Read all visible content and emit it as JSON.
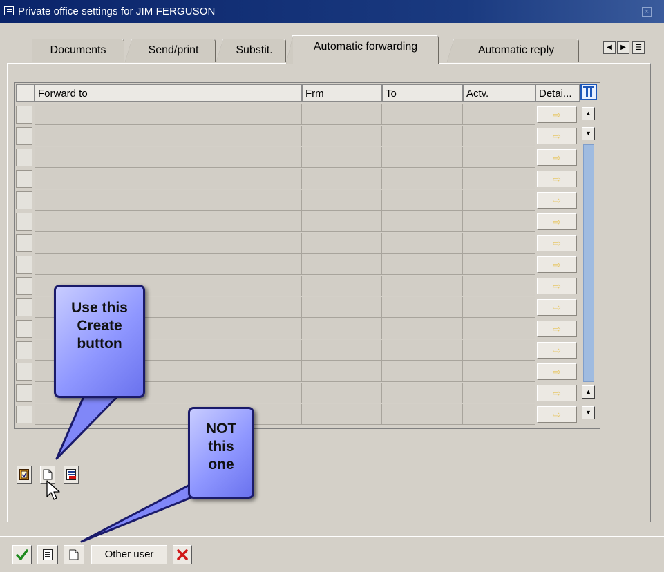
{
  "window": {
    "title": "Private office settings for JIM FERGUSON"
  },
  "tabs": [
    {
      "label": "Documents",
      "active": false
    },
    {
      "label": "Send/print",
      "active": false
    },
    {
      "label": "Substit.",
      "active": false
    },
    {
      "label": "Automatic forwarding",
      "active": true
    },
    {
      "label": "Automatic reply",
      "active": false
    }
  ],
  "table": {
    "columns": [
      "Forward to",
      "Frm",
      "To",
      "Actv.",
      "Detai..."
    ],
    "row_count": 15
  },
  "bottom_toolbar": {
    "other_user_label": "Other user"
  },
  "callouts": {
    "create": "Use this Create button",
    "not_this": "NOT this one"
  },
  "colors": {
    "title_bar": "#0a246a",
    "callout_fill": "#8f97ff",
    "callout_border": "#1a1a6a",
    "scroll_track": "#9fbbe0",
    "detail_arrow": "#e8c86a"
  },
  "icons": [
    "window-icon",
    "close-icon",
    "tab-scroll-left-icon",
    "tab-scroll-right-icon",
    "tab-list-icon",
    "column-settings-icon",
    "detail-arrow-icon",
    "scroll-up-icon",
    "scroll-down-icon",
    "select-all-icon",
    "create-icon",
    "delete-icon",
    "check-icon",
    "document-list-icon",
    "new-document-icon",
    "cancel-icon",
    "mouse-pointer-icon"
  ]
}
